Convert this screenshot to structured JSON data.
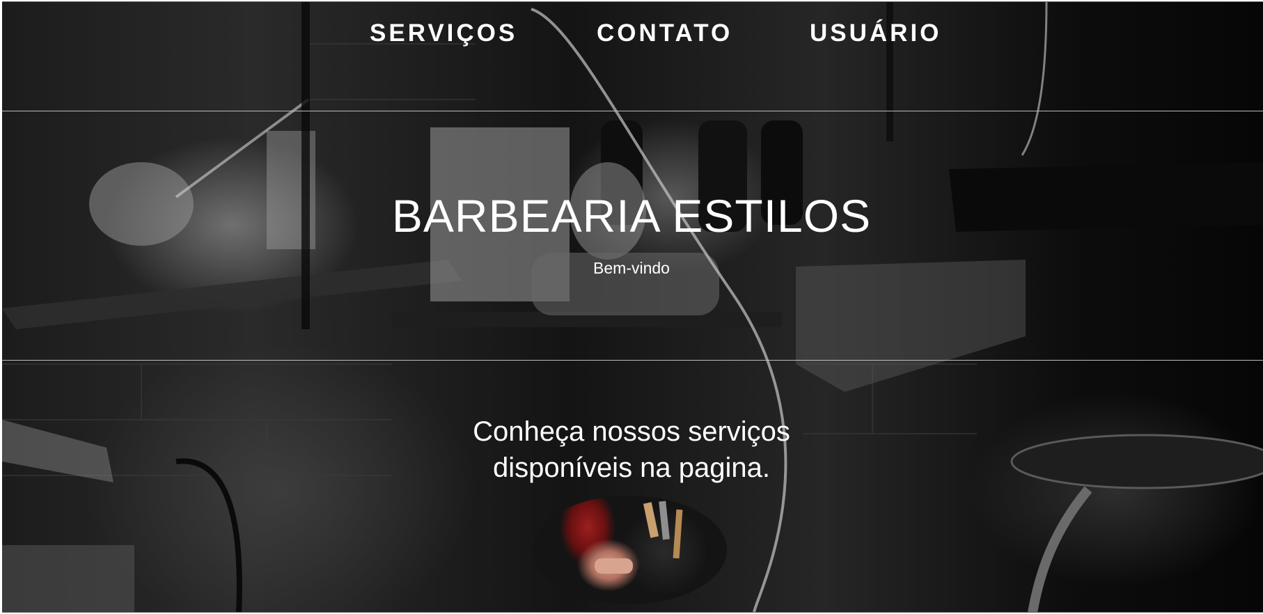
{
  "nav": {
    "items": [
      {
        "label": "SERVIÇOS"
      },
      {
        "label": "CONTATO"
      },
      {
        "label": "USUÁRIO"
      }
    ]
  },
  "hero": {
    "title": "BARBEARIA ESTILOS",
    "subtitle": "Bem-vindo"
  },
  "services": {
    "text_line1": "Conheça nossos serviços",
    "text_line2": "disponíveis na pagina."
  },
  "colors": {
    "text": "#ffffff",
    "divider": "#bdbdbd",
    "background": "#1a1a1a"
  }
}
